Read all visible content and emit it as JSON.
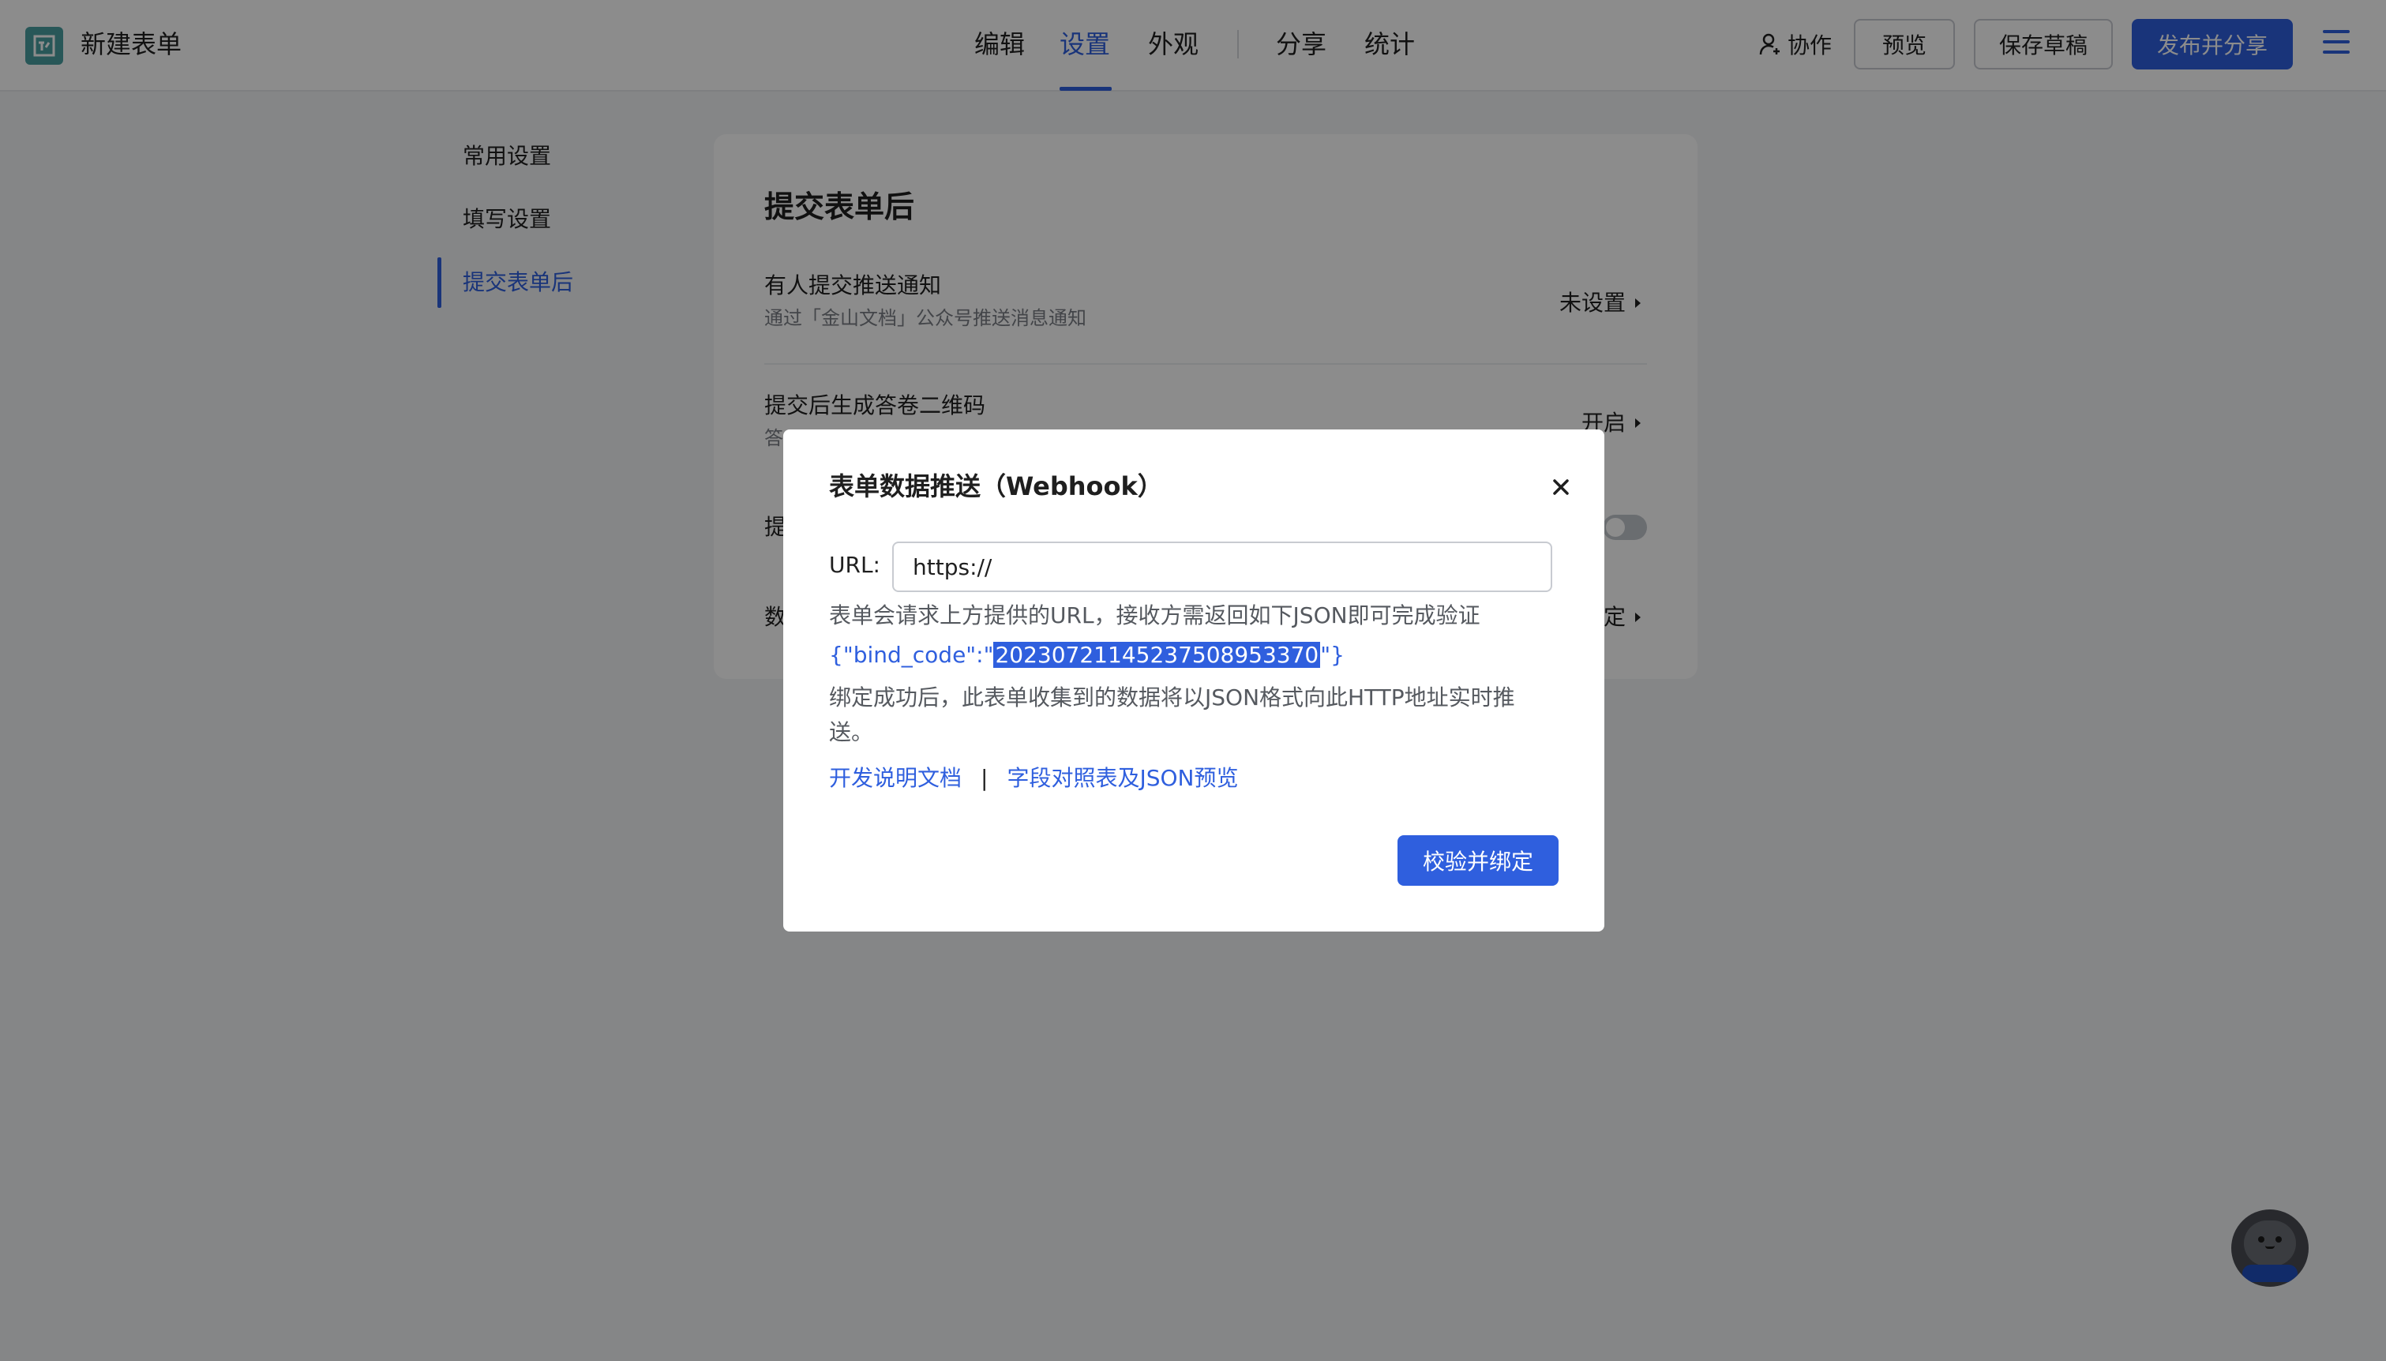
{
  "header": {
    "doc_title": "新建表单",
    "nav": [
      "编辑",
      "设置",
      "外观",
      "分享",
      "统计"
    ],
    "active_nav": "设置",
    "collab_label": "协作",
    "preview_label": "预览",
    "save_draft_label": "保存草稿",
    "publish_label": "发布并分享"
  },
  "sidebar": {
    "items": [
      {
        "label": "常用设置"
      },
      {
        "label": "填写设置"
      },
      {
        "label": "提交表单后"
      }
    ],
    "active": "提交表单后"
  },
  "card": {
    "title": "提交表单后",
    "rows": [
      {
        "title": "有人提交推送通知",
        "subtitle": "通过「金山文档」公众号推送消息通知",
        "value": "未设置"
      },
      {
        "title": "提交后生成答卷二维码",
        "subtitle": "答",
        "value": "开启"
      },
      {
        "title": "提",
        "value": ""
      },
      {
        "title": "数",
        "value": "定"
      }
    ]
  },
  "modal": {
    "title": "表单数据推送（Webhook）",
    "url_label": "URL:",
    "url_value": "https://",
    "desc1": "表单会请求上方提供的URL，接收方需返回如下JSON即可完成验证",
    "code_prefix": "{\"bind_code\":\"",
    "code_value": "20230721145237508953370",
    "code_suffix": "\"}",
    "desc2": "绑定成功后，此表单收集到的数据将以JSON格式向此HTTP地址实时推送。",
    "link_docs": "开发说明文档",
    "link_sep": "|",
    "link_fields": "字段对照表及JSON预览",
    "bind_button": "校验并绑定"
  },
  "colors": {
    "accent": "#2f5fde",
    "logo": "#4a9ea1"
  }
}
